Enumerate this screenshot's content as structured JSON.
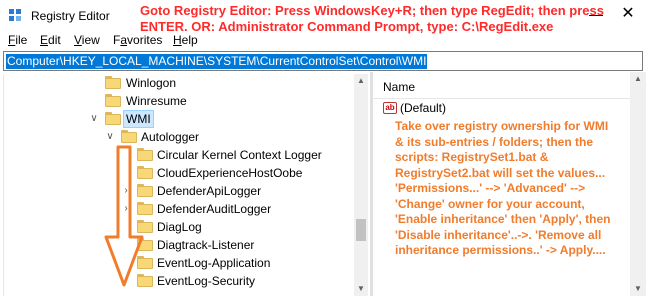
{
  "window": {
    "title": "Registry Editor",
    "minimize_glyph": "—",
    "close_glyph": "✕"
  },
  "menu": {
    "items": [
      "File",
      "Edit",
      "View",
      "Favorites",
      "Help"
    ],
    "mnemonics": [
      "F",
      "E",
      "V",
      "a",
      "H"
    ]
  },
  "annotation": {
    "lines": [
      "Goto Registry Editor: Press WindowsKey+R; then type RegEdit; then press",
      "ENTER. OR: Administrator Command Prompt, type: C:\\RegEdit.exe"
    ],
    "color": "#ff2a2a"
  },
  "address": {
    "value": "Computer\\HKEY_LOCAL_MACHINE\\SYSTEM\\CurrentControlSet\\Control\\WMI"
  },
  "tree": {
    "rows": [
      {
        "label": "Winlogon",
        "depth": 0,
        "expanded": false,
        "selected": false,
        "chevron": ""
      },
      {
        "label": "Winresume",
        "depth": 0,
        "expanded": false,
        "selected": false,
        "chevron": ""
      },
      {
        "label": "WMI",
        "depth": 0,
        "expanded": true,
        "selected": true,
        "chevron": "∨"
      },
      {
        "label": "Autologger",
        "depth": 1,
        "expanded": true,
        "selected": false,
        "chevron": "∨"
      },
      {
        "label": "Circular Kernel Context Logger",
        "depth": 2,
        "expanded": false,
        "selected": false,
        "chevron": ""
      },
      {
        "label": "CloudExperienceHostOobe",
        "depth": 2,
        "expanded": false,
        "selected": false,
        "chevron": ""
      },
      {
        "label": "DefenderApiLogger",
        "depth": 2,
        "expanded": false,
        "selected": false,
        "chevron": "›"
      },
      {
        "label": "DefenderAuditLogger",
        "depth": 2,
        "expanded": false,
        "selected": false,
        "chevron": "›"
      },
      {
        "label": "DiagLog",
        "depth": 2,
        "expanded": false,
        "selected": false,
        "chevron": ""
      },
      {
        "label": "Diagtrack-Listener",
        "depth": 2,
        "expanded": false,
        "selected": false,
        "chevron": ""
      },
      {
        "label": "EventLog-Application",
        "depth": 2,
        "expanded": false,
        "selected": false,
        "chevron": ""
      },
      {
        "label": "EventLog-Security",
        "depth": 2,
        "expanded": false,
        "selected": false,
        "chevron": ""
      }
    ]
  },
  "values": {
    "column_name": "Name",
    "rows": [
      {
        "icon": "ab-string-icon",
        "icon_text": "ab",
        "name": "(Default)"
      }
    ]
  },
  "note": {
    "lines": [
      "Take over registry ownership for WMI",
      "& its sub-entries / folders; then the",
      "scripts: RegistrySet1.bat &",
      "RegistrySet2.bat will set the values...",
      "'Permissions...' --> 'Advanced' -->",
      "'Change' owner for your account,",
      "'Enable inheritance' then 'Apply', then",
      "'Disable inheritance'..->. 'Remove all",
      "inheritance permissions..' -> Apply...."
    ],
    "color": "#f07c2c"
  },
  "icons": {
    "app": "registry-editor-icon",
    "folder": "folder-icon",
    "arrow": "orange-down-arrow-icon"
  }
}
